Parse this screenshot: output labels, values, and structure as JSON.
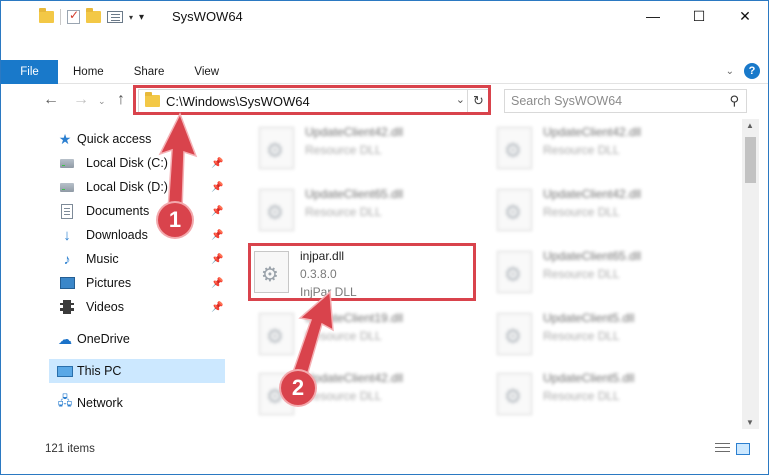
{
  "window": {
    "title": "SysWOW64",
    "controls": {
      "minimize": "—",
      "maximize": "☐",
      "close": "✕"
    }
  },
  "ribbon": {
    "tabs": [
      "File",
      "Home",
      "Share",
      "View"
    ],
    "expand_icon": "chevron-down-icon",
    "help": "?"
  },
  "navigation": {
    "back": "←",
    "forward": "→",
    "history": "⌄",
    "up": "↑",
    "address": "C:\\Windows\\SysWOW64",
    "address_dropdown": "⌄",
    "refresh": "↻",
    "search_placeholder": "Search SysWOW64"
  },
  "sidebar": {
    "quick_access": "Quick access",
    "items": [
      {
        "label": "Local Disk (C:)",
        "icon": "disk-icon",
        "pinned": true
      },
      {
        "label": "Local Disk (D:)",
        "icon": "disk-icon",
        "pinned": true
      },
      {
        "label": "Documents",
        "icon": "documents-icon",
        "pinned": true
      },
      {
        "label": "Downloads",
        "icon": "downloads-icon",
        "pinned": true
      },
      {
        "label": "Music",
        "icon": "music-icon",
        "pinned": true
      },
      {
        "label": "Pictures",
        "icon": "pictures-icon",
        "pinned": true
      },
      {
        "label": "Videos",
        "icon": "videos-icon",
        "pinned": true
      }
    ],
    "onedrive": "OneDrive",
    "this_pc": "This PC",
    "network": "Network"
  },
  "files": {
    "left_column": [
      {
        "name": "UpdateClient42.dll",
        "line2": "Resource DLL",
        "line3": "",
        "blurred": true
      },
      {
        "name": "UpdateClient65.dll",
        "line2": "Resource DLL",
        "line3": "",
        "blurred": true
      },
      {
        "name": "injpar.dll",
        "line2": "0.3.8.0",
        "line3": "InjPar DLL",
        "blurred": false
      },
      {
        "name": "UpdateClient19.dll",
        "line2": "Resource DLL",
        "line3": "",
        "blurred": true
      },
      {
        "name": "UpdateClient42.dll",
        "line2": "Resource DLL",
        "line3": "",
        "blurred": true
      }
    ],
    "right_column": [
      {
        "name": "UpdateClient42.dll",
        "line2": "Resource DLL",
        "line3": "",
        "blurred": true
      },
      {
        "name": "UpdateClient42.dll",
        "line2": "Resource DLL",
        "line3": "",
        "blurred": true
      },
      {
        "name": "UpdateClient65.dll",
        "line2": "Resource DLL",
        "line3": "",
        "blurred": true
      },
      {
        "name": "UpdateClient5.dll",
        "line2": "Resource DLL",
        "line3": "",
        "blurred": true
      },
      {
        "name": "UpdateClient5.dll",
        "line2": "Resource DLL",
        "line3": "",
        "blurred": true
      }
    ]
  },
  "status": {
    "item_count": "121 items"
  },
  "callouts": {
    "step1": "1",
    "step2": "2",
    "highlight_color": "#d9434c"
  },
  "colors": {
    "accent": "#1979ca",
    "selection": "#cce8ff",
    "folder": "#f3c846"
  }
}
